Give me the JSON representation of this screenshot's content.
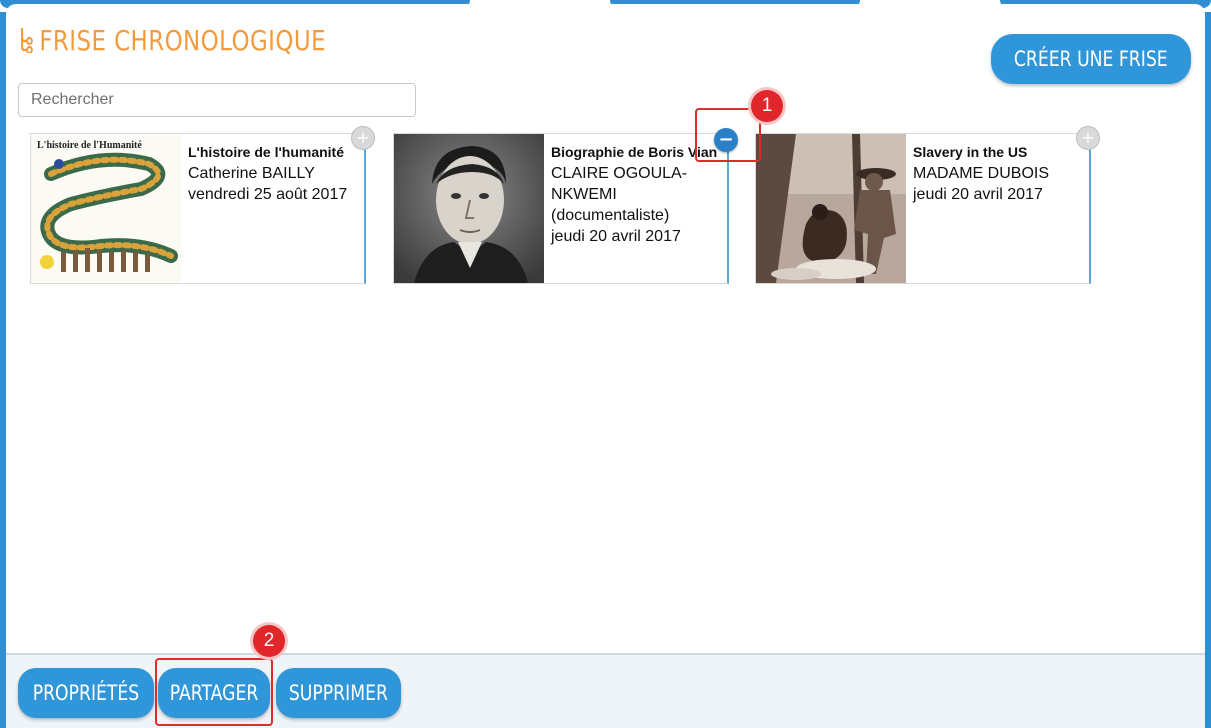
{
  "header": {
    "title": "FRISE CHRONOLOGIQUE",
    "create_label": "CRÉER UNE FRISE"
  },
  "search": {
    "placeholder": "Rechercher",
    "value": ""
  },
  "cards": [
    {
      "title": "L'histoire de l'humanité",
      "author": "Catherine BAILLY",
      "date": "vendredi 25 août 2017",
      "image_caption": "L'histoire de l'Humanité",
      "toggle": "+"
    },
    {
      "title": "Biographie de Boris Vian",
      "author": "CLAIRE OGOULA-NKWEMI (documentaliste)",
      "date": "jeudi 20 avril 2017",
      "toggle": "−"
    },
    {
      "title": "Slavery in the US",
      "author": "MADAME DUBOIS",
      "date": "jeudi 20 avril 2017",
      "toggle": "+"
    }
  ],
  "annotations": [
    "1",
    "2"
  ],
  "footer": {
    "properties_label": "PROPRIÉTÉS",
    "share_label": "PARTAGER",
    "delete_label": "SUPPRIMER"
  },
  "colors": {
    "accent_orange": "#f39a3c",
    "button_blue": "#2f96d9",
    "annotation_red": "#e0262b"
  },
  "icons": {
    "title_icon": "timeline-icon",
    "add": "plus-icon",
    "remove": "minus-icon"
  }
}
